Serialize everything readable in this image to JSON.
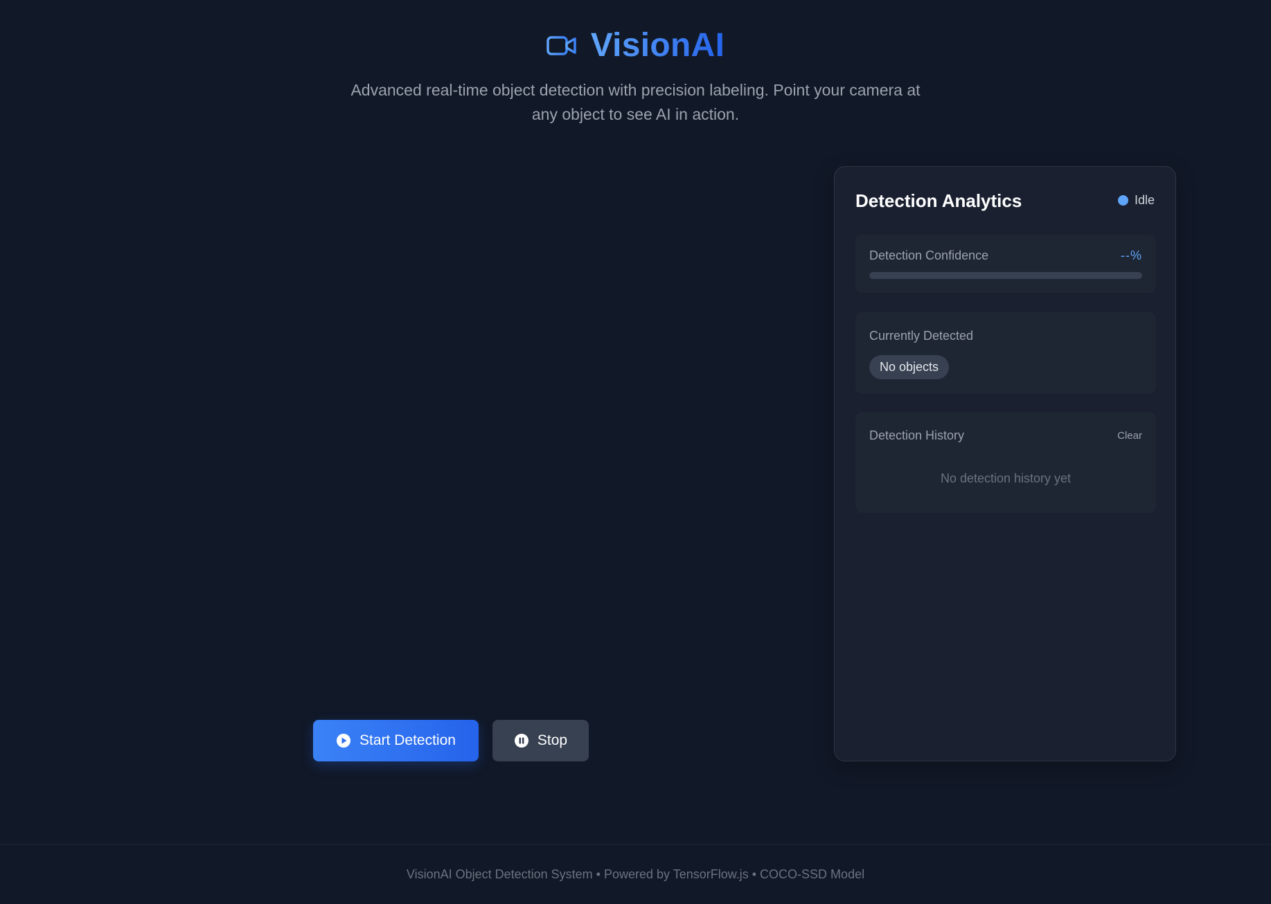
{
  "header": {
    "title": "VisionAI",
    "subtitle": "Advanced real-time object detection with precision labeling. Point your camera at any object to see AI in action.",
    "icon": "video-camera-icon",
    "accent_color": "#3b82f6"
  },
  "controls": {
    "start_label": "Start Detection",
    "start_icon": "play-circle-icon",
    "stop_label": "Stop",
    "stop_icon": "pause-circle-icon"
  },
  "analytics": {
    "title": "Detection Analytics",
    "status": "Idle",
    "status_color": "#60a5fa",
    "confidence": {
      "label": "Detection Confidence",
      "value": "--%",
      "progress_percent": 0
    },
    "current": {
      "label": "Currently Detected",
      "empty_text": "No objects"
    },
    "history": {
      "label": "Detection History",
      "clear_label": "Clear",
      "empty_text": "No detection history yet"
    }
  },
  "footer": {
    "text": "VisionAI Object Detection System • Powered by TensorFlow.js • COCO-SSD Model"
  }
}
